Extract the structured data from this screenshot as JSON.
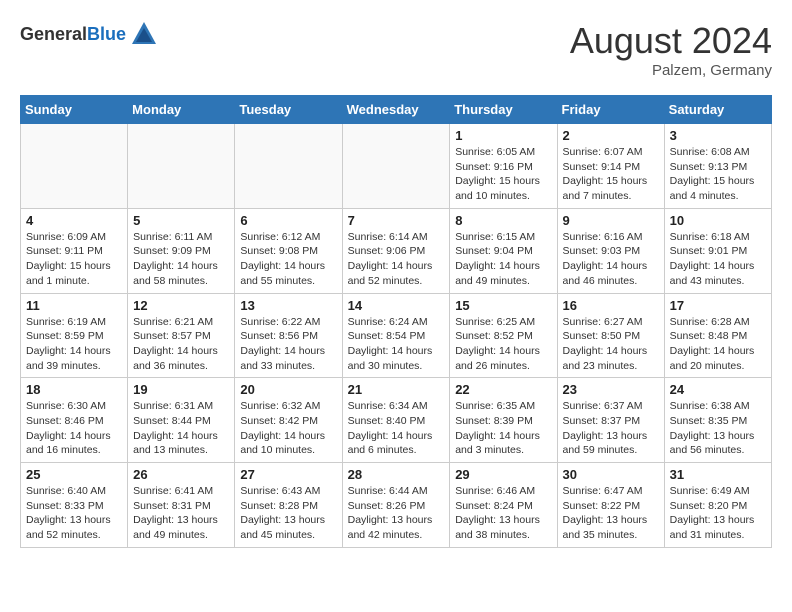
{
  "header": {
    "logo_general": "General",
    "logo_blue": "Blue",
    "month_title": "August 2024",
    "location": "Palzem, Germany"
  },
  "days_of_week": [
    "Sunday",
    "Monday",
    "Tuesday",
    "Wednesday",
    "Thursday",
    "Friday",
    "Saturday"
  ],
  "weeks": [
    [
      {
        "day": "",
        "info": ""
      },
      {
        "day": "",
        "info": ""
      },
      {
        "day": "",
        "info": ""
      },
      {
        "day": "",
        "info": ""
      },
      {
        "day": "1",
        "info": "Sunrise: 6:05 AM\nSunset: 9:16 PM\nDaylight: 15 hours\nand 10 minutes."
      },
      {
        "day": "2",
        "info": "Sunrise: 6:07 AM\nSunset: 9:14 PM\nDaylight: 15 hours\nand 7 minutes."
      },
      {
        "day": "3",
        "info": "Sunrise: 6:08 AM\nSunset: 9:13 PM\nDaylight: 15 hours\nand 4 minutes."
      }
    ],
    [
      {
        "day": "4",
        "info": "Sunrise: 6:09 AM\nSunset: 9:11 PM\nDaylight: 15 hours\nand 1 minute."
      },
      {
        "day": "5",
        "info": "Sunrise: 6:11 AM\nSunset: 9:09 PM\nDaylight: 14 hours\nand 58 minutes."
      },
      {
        "day": "6",
        "info": "Sunrise: 6:12 AM\nSunset: 9:08 PM\nDaylight: 14 hours\nand 55 minutes."
      },
      {
        "day": "7",
        "info": "Sunrise: 6:14 AM\nSunset: 9:06 PM\nDaylight: 14 hours\nand 52 minutes."
      },
      {
        "day": "8",
        "info": "Sunrise: 6:15 AM\nSunset: 9:04 PM\nDaylight: 14 hours\nand 49 minutes."
      },
      {
        "day": "9",
        "info": "Sunrise: 6:16 AM\nSunset: 9:03 PM\nDaylight: 14 hours\nand 46 minutes."
      },
      {
        "day": "10",
        "info": "Sunrise: 6:18 AM\nSunset: 9:01 PM\nDaylight: 14 hours\nand 43 minutes."
      }
    ],
    [
      {
        "day": "11",
        "info": "Sunrise: 6:19 AM\nSunset: 8:59 PM\nDaylight: 14 hours\nand 39 minutes."
      },
      {
        "day": "12",
        "info": "Sunrise: 6:21 AM\nSunset: 8:57 PM\nDaylight: 14 hours\nand 36 minutes."
      },
      {
        "day": "13",
        "info": "Sunrise: 6:22 AM\nSunset: 8:56 PM\nDaylight: 14 hours\nand 33 minutes."
      },
      {
        "day": "14",
        "info": "Sunrise: 6:24 AM\nSunset: 8:54 PM\nDaylight: 14 hours\nand 30 minutes."
      },
      {
        "day": "15",
        "info": "Sunrise: 6:25 AM\nSunset: 8:52 PM\nDaylight: 14 hours\nand 26 minutes."
      },
      {
        "day": "16",
        "info": "Sunrise: 6:27 AM\nSunset: 8:50 PM\nDaylight: 14 hours\nand 23 minutes."
      },
      {
        "day": "17",
        "info": "Sunrise: 6:28 AM\nSunset: 8:48 PM\nDaylight: 14 hours\nand 20 minutes."
      }
    ],
    [
      {
        "day": "18",
        "info": "Sunrise: 6:30 AM\nSunset: 8:46 PM\nDaylight: 14 hours\nand 16 minutes."
      },
      {
        "day": "19",
        "info": "Sunrise: 6:31 AM\nSunset: 8:44 PM\nDaylight: 14 hours\nand 13 minutes."
      },
      {
        "day": "20",
        "info": "Sunrise: 6:32 AM\nSunset: 8:42 PM\nDaylight: 14 hours\nand 10 minutes."
      },
      {
        "day": "21",
        "info": "Sunrise: 6:34 AM\nSunset: 8:40 PM\nDaylight: 14 hours\nand 6 minutes."
      },
      {
        "day": "22",
        "info": "Sunrise: 6:35 AM\nSunset: 8:39 PM\nDaylight: 14 hours\nand 3 minutes."
      },
      {
        "day": "23",
        "info": "Sunrise: 6:37 AM\nSunset: 8:37 PM\nDaylight: 13 hours\nand 59 minutes."
      },
      {
        "day": "24",
        "info": "Sunrise: 6:38 AM\nSunset: 8:35 PM\nDaylight: 13 hours\nand 56 minutes."
      }
    ],
    [
      {
        "day": "25",
        "info": "Sunrise: 6:40 AM\nSunset: 8:33 PM\nDaylight: 13 hours\nand 52 minutes."
      },
      {
        "day": "26",
        "info": "Sunrise: 6:41 AM\nSunset: 8:31 PM\nDaylight: 13 hours\nand 49 minutes."
      },
      {
        "day": "27",
        "info": "Sunrise: 6:43 AM\nSunset: 8:28 PM\nDaylight: 13 hours\nand 45 minutes."
      },
      {
        "day": "28",
        "info": "Sunrise: 6:44 AM\nSunset: 8:26 PM\nDaylight: 13 hours\nand 42 minutes."
      },
      {
        "day": "29",
        "info": "Sunrise: 6:46 AM\nSunset: 8:24 PM\nDaylight: 13 hours\nand 38 minutes."
      },
      {
        "day": "30",
        "info": "Sunrise: 6:47 AM\nSunset: 8:22 PM\nDaylight: 13 hours\nand 35 minutes."
      },
      {
        "day": "31",
        "info": "Sunrise: 6:49 AM\nSunset: 8:20 PM\nDaylight: 13 hours\nand 31 minutes."
      }
    ]
  ]
}
